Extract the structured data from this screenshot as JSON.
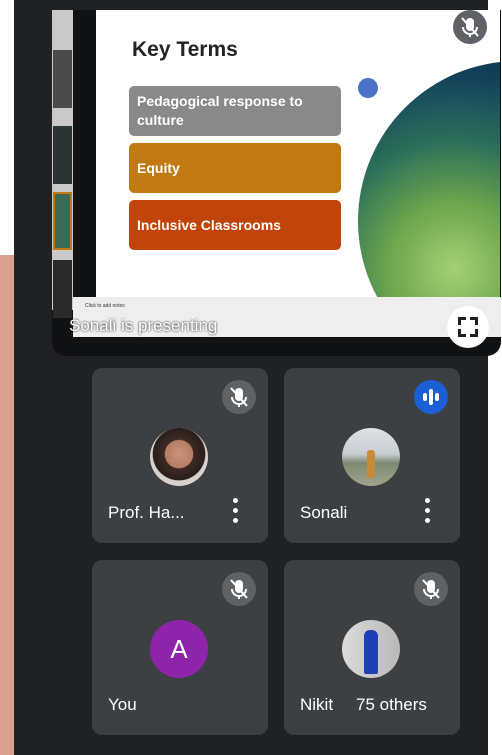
{
  "presentation": {
    "label": "Sonali is presenting",
    "slide": {
      "title": "Key Terms",
      "terms": [
        {
          "text": "Pedagogical response to culture",
          "color": "#898989"
        },
        {
          "text": "Equity",
          "color": "#c17a12"
        },
        {
          "text": "Inclusive Classrooms",
          "color": "#c1440b"
        }
      ],
      "notes_hint": "Click to add notes"
    }
  },
  "participants": [
    {
      "name": "Prof. Ha...",
      "mic": "muted",
      "avatar": "photo"
    },
    {
      "name": "Sonali",
      "mic": "speaking",
      "avatar": "photo"
    },
    {
      "name": "You",
      "mic": "muted",
      "avatar_letter": "A",
      "avatar_color": "#8e24aa"
    },
    {
      "name": "Nikit",
      "mic": "muted",
      "avatar": "photo"
    }
  ],
  "others_chip": "75 others",
  "colors": {
    "background": "#202124",
    "tile": "#3c4043",
    "speaking": "#1a5fd6"
  }
}
